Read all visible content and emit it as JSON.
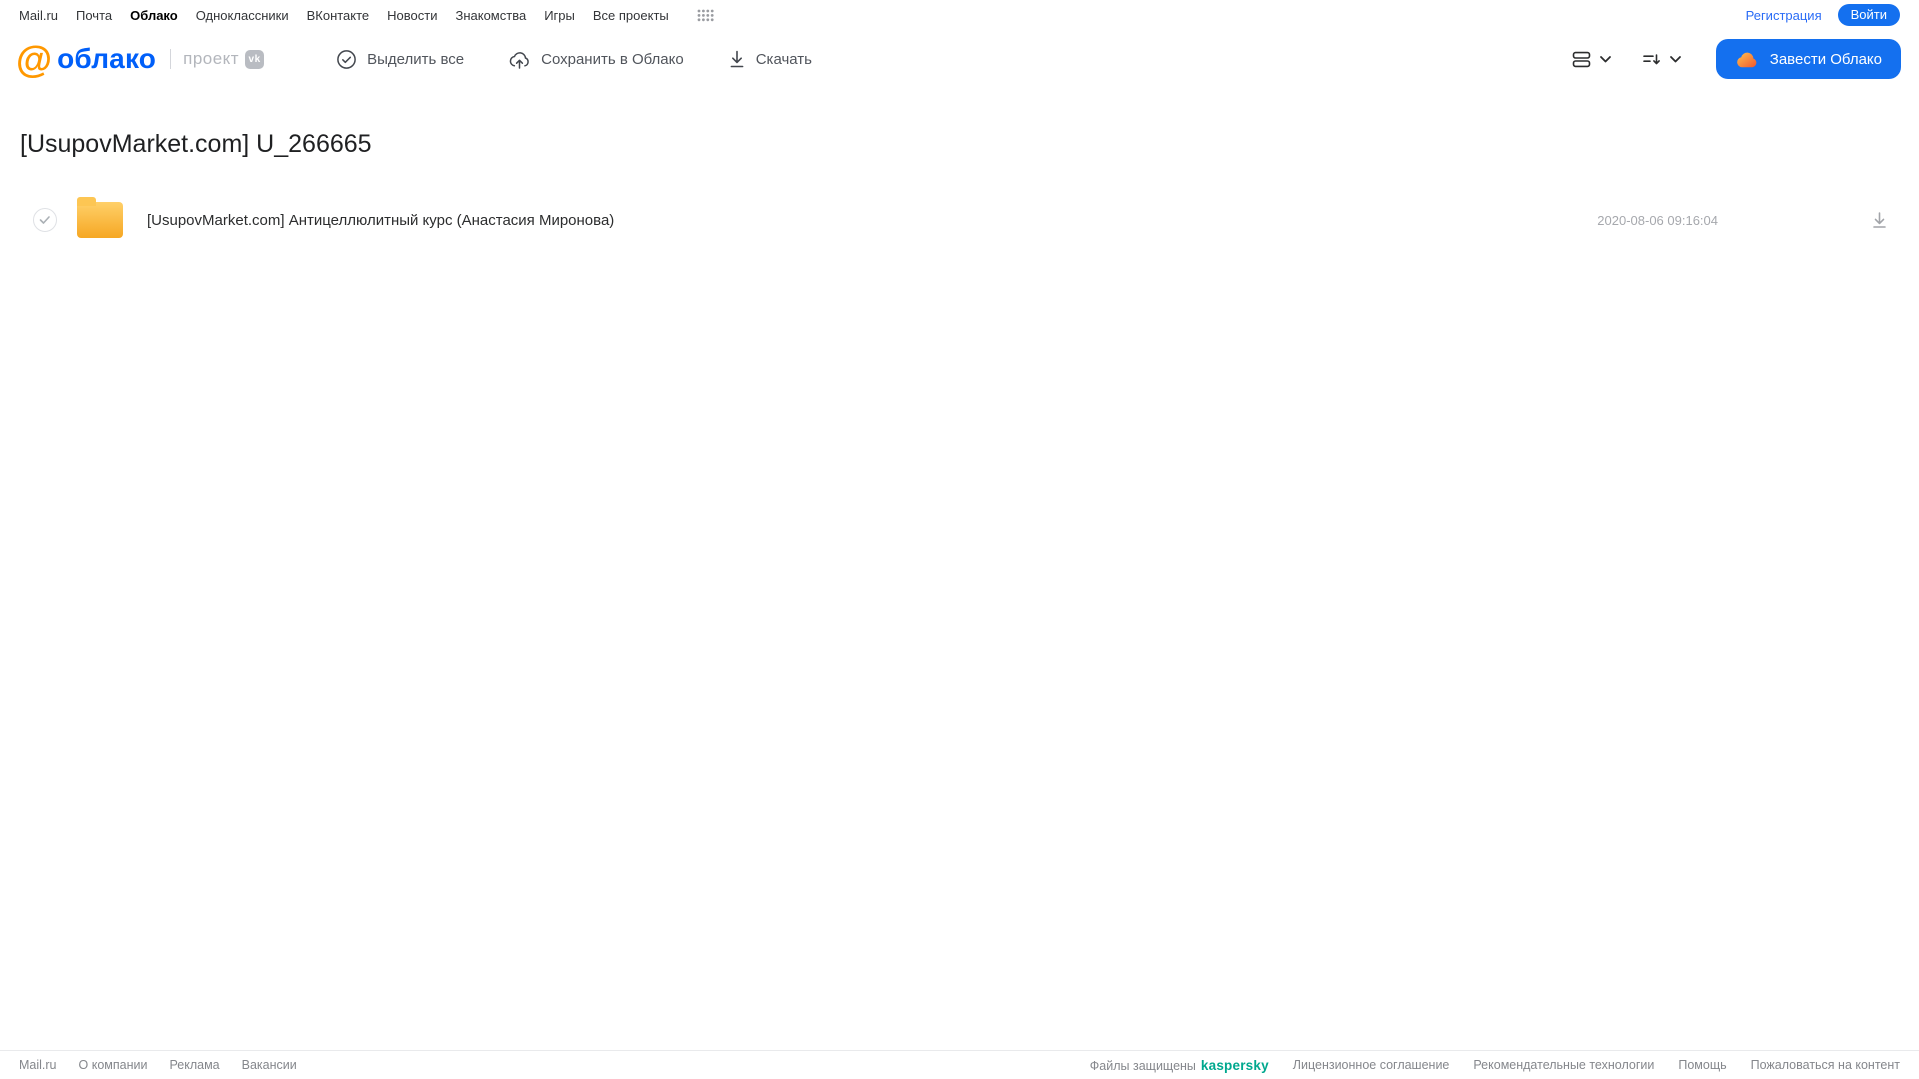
{
  "topnav": {
    "items": [
      "Mail.ru",
      "Почта",
      "Облако",
      "Одноклассники",
      "ВКонтакте",
      "Новости",
      "Знакомства",
      "Игры",
      "Все проекты"
    ],
    "registration_label": "Регистрация",
    "login_label": "Войти"
  },
  "header": {
    "logo_at": "@",
    "logo_word": "облако",
    "project_label": "проект",
    "vk_badge": "vk",
    "toolbar": {
      "select_all": "Выделить все",
      "save_to_cloud": "Сохранить в Облако",
      "download": "Скачать"
    },
    "create_cloud_button": "Завести Облако"
  },
  "main": {
    "title": "[UsupovMarket.com] U_266665",
    "files": [
      {
        "type": "folder",
        "name": "[UsupovMarket.com] Антицеллюлитный курс (Анастасия Миронова)",
        "date": "2020-08-06 09:16:04"
      }
    ]
  },
  "footer": {
    "left_links": [
      "Mail.ru",
      "О компании",
      "Реклама",
      "Вакансии"
    ],
    "protected_label": "Файлы защищены",
    "kaspersky_logo": "kaspersky",
    "right_links": [
      "Лицензионное соглашение",
      "Рекомендательные технологии",
      "Помощь",
      "Пожаловаться на контент"
    ]
  },
  "colors": {
    "brand_blue": "#005ff9",
    "button_blue": "#1470ef",
    "logo_orange": "#ff9800",
    "folder_yellow": "#f6a723",
    "kaspersky_teal": "#00a88e"
  }
}
